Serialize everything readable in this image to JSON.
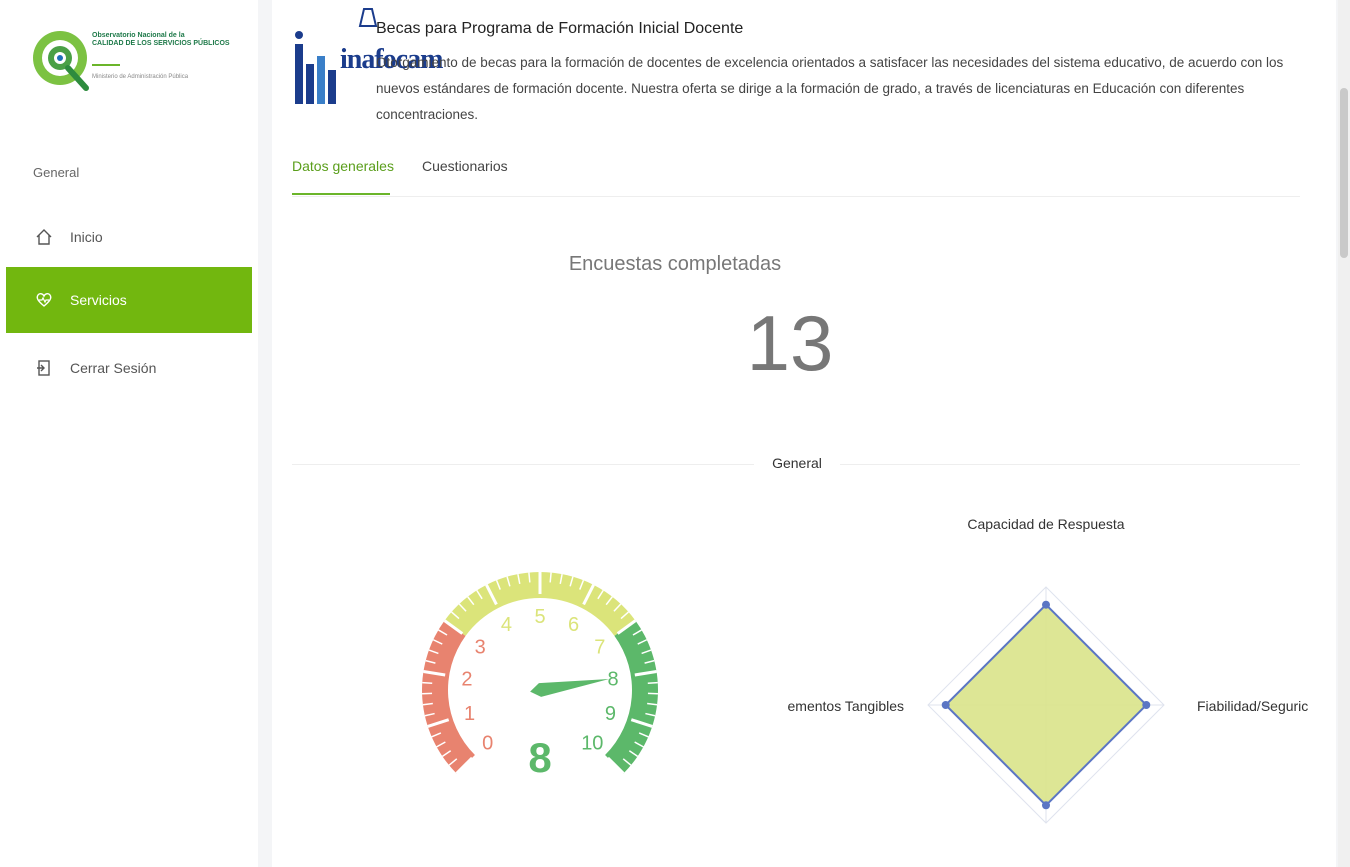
{
  "sidebar": {
    "logo": {
      "line1": "Observatorio Nacional de la",
      "line2": "CALIDAD DE LOS SERVICIOS PÚBLICOS",
      "subtitle": "Ministerio de Administración Pública"
    },
    "section_label": "General",
    "items": [
      {
        "label": "Inicio",
        "icon": "home-icon"
      },
      {
        "label": "Servicios",
        "icon": "heart-pulse-icon",
        "active": true
      },
      {
        "label": "Cerrar Sesión",
        "icon": "logout-icon"
      }
    ]
  },
  "service": {
    "institution_logo_text": "inafocam",
    "title": "Becas para Programa de Formación Inicial Docente",
    "description": "Otorgamiento de becas para la formación de docentes de excelencia orientados a satisfacer las necesidades del sistema educativo, de acuerdo con los nuevos estándares de formación docente. Nuestra oferta se dirige a la formación de grado, a través de licenciaturas en Educación con diferentes concentraciones."
  },
  "tabs": [
    {
      "label": "Datos generales",
      "active": true
    },
    {
      "label": "Cuestionarios",
      "active": false
    }
  ],
  "kpi": {
    "label": "Encuestas completadas",
    "value": "13"
  },
  "section": {
    "label": "General"
  },
  "chart_data": [
    {
      "type": "gauge",
      "min": 0,
      "max": 10,
      "value": 8,
      "tick_labels": [
        "0",
        "1",
        "2",
        "3",
        "4",
        "5",
        "6",
        "7",
        "8",
        "9",
        "10"
      ],
      "center_label": "8",
      "bands": [
        {
          "from": 0,
          "to": 3,
          "color": "#e8836f"
        },
        {
          "from": 3,
          "to": 7,
          "color": "#dbe47a"
        },
        {
          "from": 7,
          "to": 10,
          "color": "#5cb86a"
        }
      ]
    },
    {
      "type": "radar",
      "axes": [
        "Capacidad de Respuesta",
        "Fiabilidad/Seguric",
        "",
        "ementos Tangibles"
      ],
      "max": 10,
      "series": [
        {
          "values": [
            8.5,
            8.5,
            8.5,
            8.5
          ],
          "color": "#d9e38a"
        }
      ]
    }
  ],
  "colors": {
    "accent": "#72b70f",
    "tab_active": "#5a9e1b"
  }
}
